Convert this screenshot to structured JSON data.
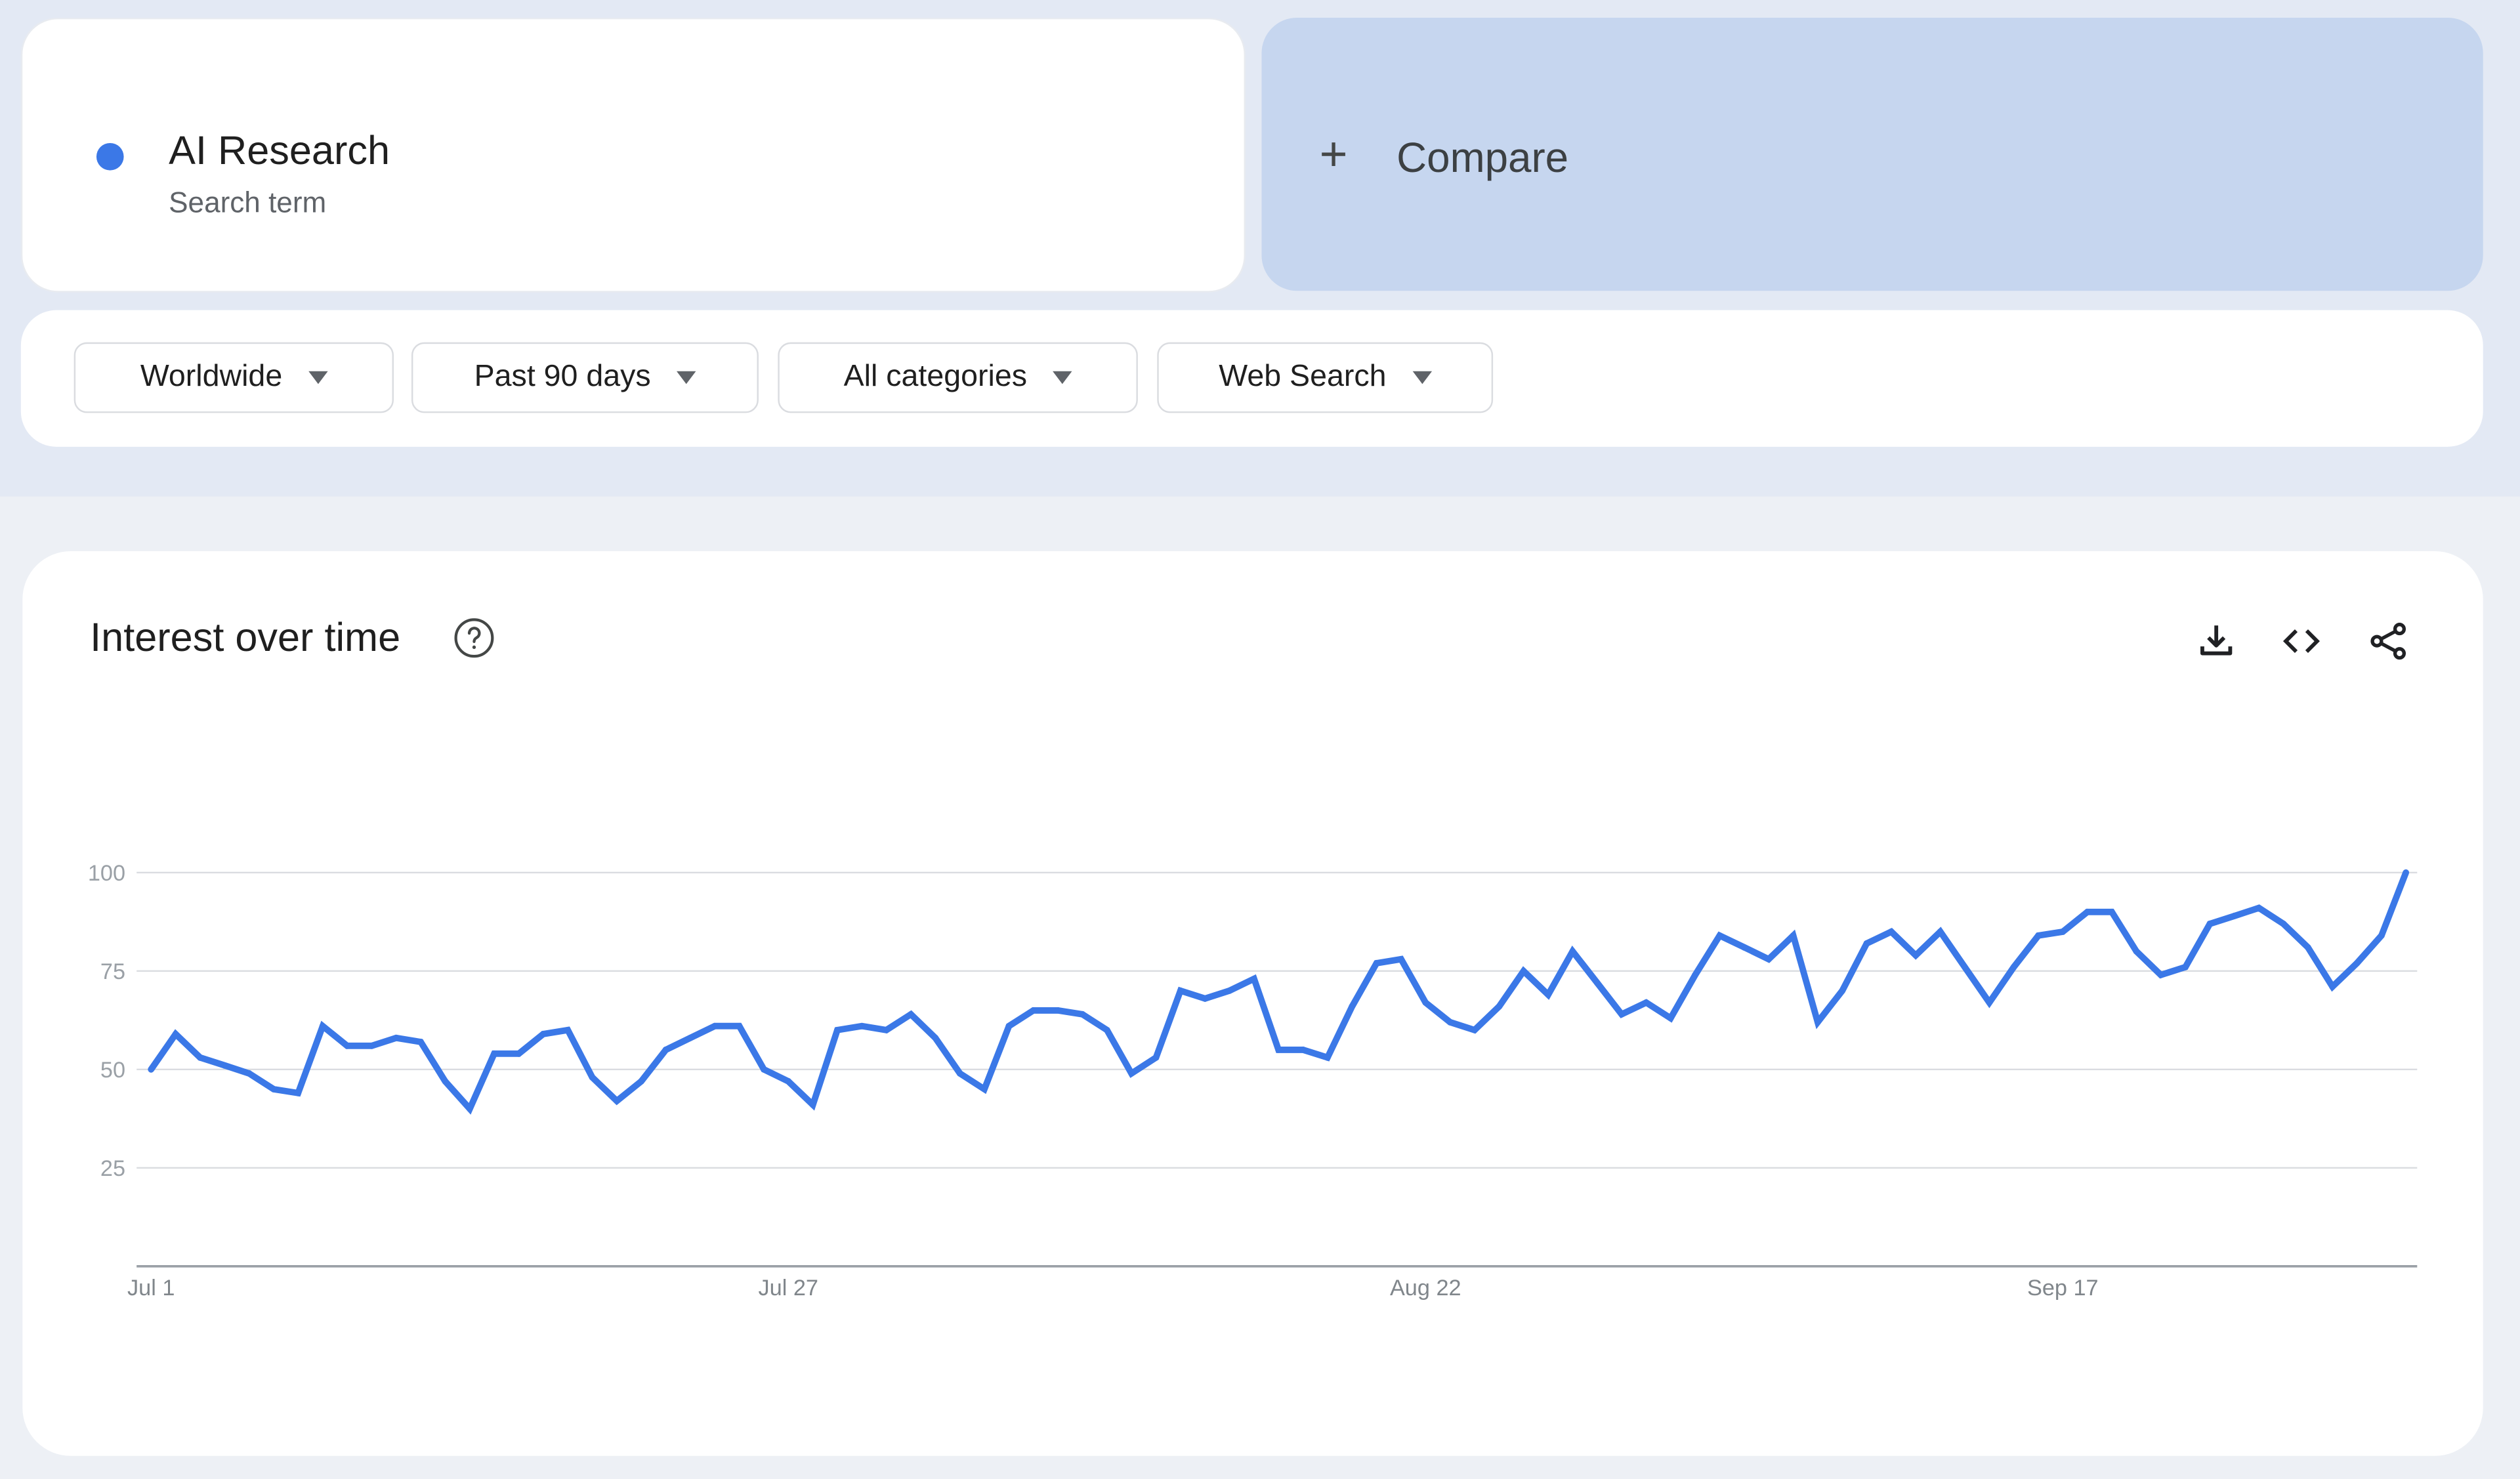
{
  "search_term": {
    "name": "AI Research",
    "type_label": "Search term",
    "color": "#3b78e7"
  },
  "compare": {
    "icon": "plus-icon",
    "label": "Compare"
  },
  "filters": [
    {
      "label": "Worldwide",
      "icon": "caret-down-icon"
    },
    {
      "label": "Past 90 days",
      "icon": "caret-down-icon"
    },
    {
      "label": "All categories",
      "icon": "caret-down-icon"
    },
    {
      "label": "Web Search",
      "icon": "caret-down-icon"
    }
  ],
  "chart_card": {
    "title": "Interest over time",
    "help_icon": "help-circle-icon",
    "actions": [
      "download-icon",
      "embed-code-icon",
      "share-icon"
    ]
  },
  "chart_data": {
    "type": "line",
    "title": "Interest over time",
    "xlabel": "",
    "ylabel": "",
    "ylim": [
      0,
      100
    ],
    "yticks": [
      25,
      50,
      75,
      100
    ],
    "x_tick_labels": [
      {
        "index": 0,
        "label": "Jul 1"
      },
      {
        "index": 26,
        "label": "Jul 27"
      },
      {
        "index": 52,
        "label": "Aug 22"
      },
      {
        "index": 78,
        "label": "Sep 17"
      }
    ],
    "grid": true,
    "legend": "none",
    "x_start": "Jul 1",
    "series": [
      {
        "name": "AI Research",
        "color": "#3b78e7",
        "values": [
          50,
          59,
          53,
          51,
          49,
          45,
          44,
          61,
          56,
          56,
          58,
          57,
          47,
          40,
          54,
          54,
          59,
          60,
          48,
          42,
          47,
          55,
          58,
          61,
          61,
          50,
          47,
          41,
          60,
          61,
          60,
          64,
          58,
          49,
          45,
          61,
          65,
          65,
          64,
          60,
          49,
          53,
          70,
          68,
          70,
          73,
          55,
          55,
          53,
          66,
          77,
          78,
          67,
          62,
          60,
          66,
          75,
          69,
          80,
          72,
          64,
          67,
          63,
          74,
          84,
          81,
          78,
          84,
          62,
          70,
          82,
          85,
          79,
          85,
          76,
          67,
          76,
          84,
          85,
          90,
          90,
          80,
          74,
          76,
          87,
          89,
          91,
          87,
          81,
          71,
          77,
          84,
          100
        ]
      }
    ]
  }
}
